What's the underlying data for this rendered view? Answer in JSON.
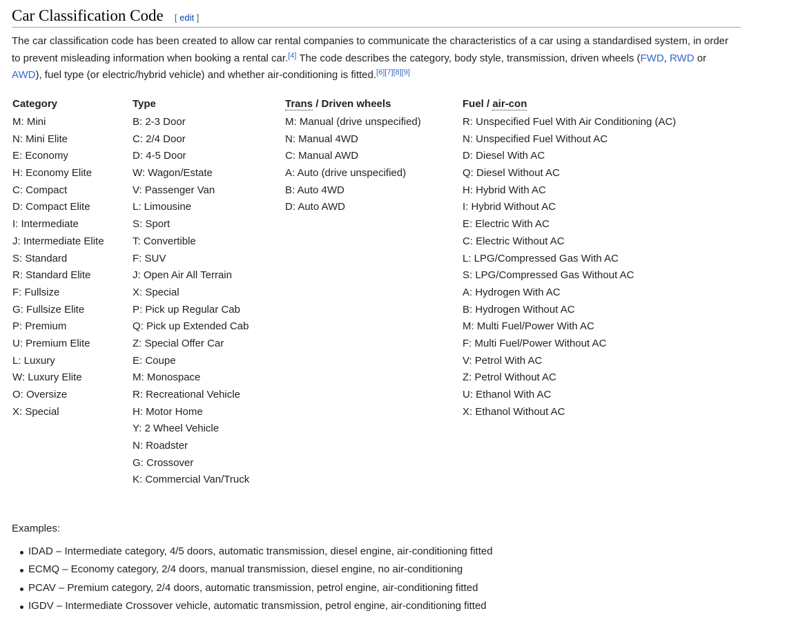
{
  "heading": {
    "title": "Car Classification Code",
    "edit_open": "[",
    "edit_label": "edit",
    "edit_close": "]"
  },
  "intro": {
    "t1": "The car classification code has been created to allow car rental companies to communicate the characteristics of a car using a standardised system, in order to prevent misleading information when booking a rental car.",
    "ref1": "[4]",
    "t2": " The code describes the category, body style, transmission, driven wheels (",
    "link_fwd": "FWD",
    "sep1": ", ",
    "link_rwd": "RWD",
    "sep2": " or ",
    "link_awd": "AWD",
    "t3": "), fuel type (or electric/hybrid vehicle) and whether air-conditioning is fitted.",
    "ref6": "[6]",
    "ref7": "[7]",
    "ref8": "[8]",
    "ref9": "[9]"
  },
  "columns": {
    "category": {
      "header": "Category",
      "items": [
        "M: Mini",
        "N: Mini Elite",
        "E: Economy",
        "H: Economy Elite",
        "C: Compact",
        "D: Compact Elite",
        "I: Intermediate",
        "J: Intermediate Elite",
        "S: Standard",
        "R: Standard Elite",
        "F: Fullsize",
        "G: Fullsize Elite",
        "P: Premium",
        "U: Premium Elite",
        "L: Luxury",
        "W: Luxury Elite",
        "O: Oversize",
        "X: Special"
      ]
    },
    "type": {
      "header": "Type",
      "items": [
        "B: 2-3 Door",
        "C: 2/4 Door",
        "D: 4-5 Door",
        "W: Wagon/Estate",
        "V: Passenger Van",
        "L: Limousine",
        "S: Sport",
        "T: Convertible",
        "F: SUV",
        "J: Open Air All Terrain",
        "X: Special",
        "P: Pick up Regular Cab",
        "Q: Pick up Extended Cab",
        "Z: Special Offer Car",
        "E: Coupe",
        "M: Monospace",
        "R: Recreational Vehicle",
        "H: Motor Home",
        "Y: 2 Wheel Vehicle",
        "N: Roadster",
        "G: Crossover",
        "K: Commercial Van/Truck"
      ]
    },
    "trans": {
      "header_abbr": "Trans",
      "header_rest": " / Driven wheels",
      "items": [
        "M: Manual (drive unspecified)",
        "N: Manual 4WD",
        "C: Manual AWD",
        "A: Auto (drive unspecified)",
        "B: Auto 4WD",
        "D: Auto AWD"
      ]
    },
    "fuel": {
      "header_pre": "Fuel / ",
      "header_abbr": "air-con",
      "items": [
        "R: Unspecified Fuel With Air Conditioning (AC)",
        "N: Unspecified Fuel Without AC",
        "D: Diesel With AC",
        "Q: Diesel Without AC",
        "H: Hybrid With AC",
        "I: Hybrid Without AC",
        "E: Electric With AC",
        "C: Electric Without AC",
        "L: LPG/Compressed Gas With AC",
        "S: LPG/Compressed Gas Without AC",
        "A: Hydrogen With AC",
        "B: Hydrogen Without AC",
        "M: Multi Fuel/Power With AC",
        "F: Multi Fuel/Power Without AC",
        "V: Petrol With AC",
        "Z: Petrol Without AC",
        "U: Ethanol With AC",
        "X: Ethanol Without AC"
      ]
    }
  },
  "examples": {
    "label": "Examples:",
    "items": [
      "IDAD – Intermediate category, 4/5 doors, automatic transmission, diesel engine, air-conditioning fitted",
      "ECMQ – Economy category, 2/4 doors, manual transmission, diesel engine, no air-conditioning",
      "PCAV – Premium category, 2/4 doors, automatic transmission, petrol engine, air-conditioning fitted",
      "IGDV – Intermediate Crossover vehicle, automatic transmission, petrol engine, air-conditioning fitted"
    ]
  }
}
